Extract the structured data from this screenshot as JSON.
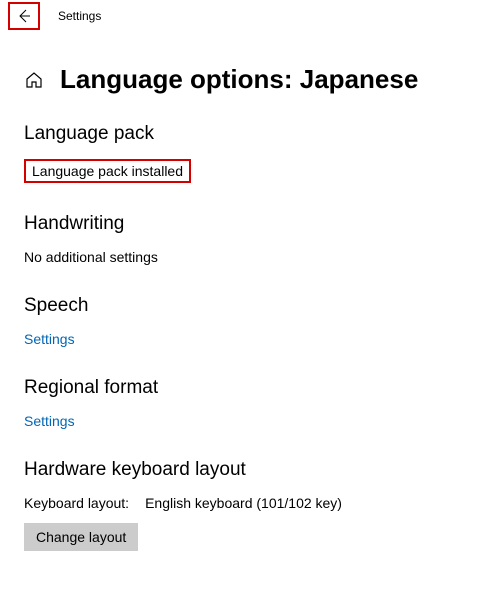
{
  "titlebar": {
    "app_title": "Settings"
  },
  "page": {
    "title": "Language options: Japanese"
  },
  "sections": {
    "language_pack": {
      "header": "Language pack",
      "status": "Language pack installed"
    },
    "handwriting": {
      "header": "Handwriting",
      "status": "No additional settings"
    },
    "speech": {
      "header": "Speech",
      "link": "Settings"
    },
    "regional": {
      "header": "Regional format",
      "link": "Settings"
    },
    "hardware": {
      "header": "Hardware keyboard layout",
      "label": "Keyboard layout:",
      "value": "English keyboard (101/102 key)",
      "button": "Change layout"
    }
  }
}
